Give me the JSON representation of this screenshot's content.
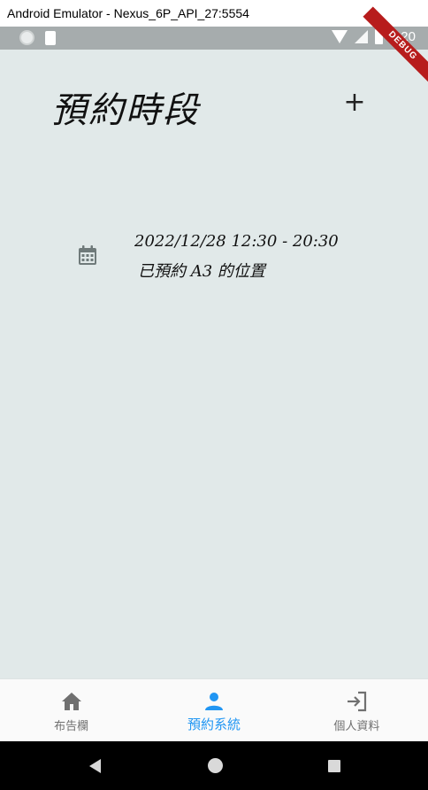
{
  "window": {
    "title": "Android Emulator - Nexus_6P_API_27:5554"
  },
  "status_bar": {
    "time": "5:20",
    "debug_label": "DEBUG"
  },
  "page": {
    "title": "預約時段",
    "add_icon": "plus-icon"
  },
  "bookings": [
    {
      "icon": "calendar-icon",
      "time": "2022/12/28 12:30 - 20:30",
      "description": "已預約 A3 的位置"
    }
  ],
  "bottom_nav": {
    "items": [
      {
        "label": "布告欄",
        "icon": "home-icon",
        "active": false
      },
      {
        "label": "預約系統",
        "icon": "person-icon",
        "active": true
      },
      {
        "label": "個人資料",
        "icon": "login-icon",
        "active": false
      }
    ],
    "active_color": "#2196f3",
    "inactive_color": "#707070"
  },
  "colors": {
    "background": "#e1e9e9",
    "status_bar": "#a6acad",
    "debug_banner": "#b71c1c"
  }
}
